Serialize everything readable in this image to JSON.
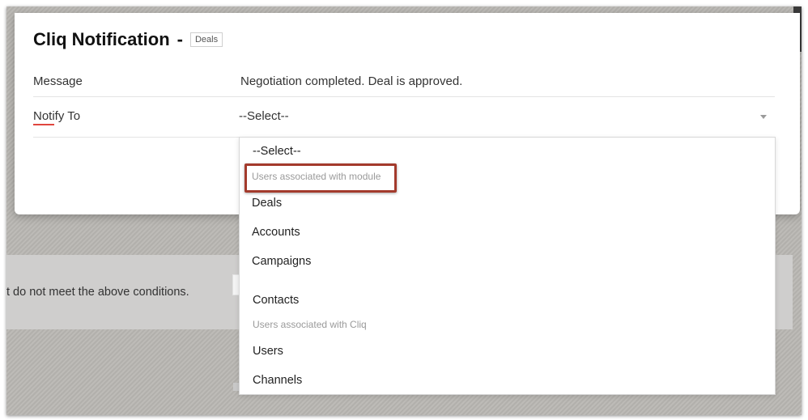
{
  "modal": {
    "title": "Cliq Notification",
    "separator": "-",
    "module_badge": "Deals"
  },
  "fields": {
    "message_label": "Message",
    "message_value": "Negotiation completed. Deal is approved.",
    "notify_label": "Notify To",
    "notify_selected": "--Select--"
  },
  "dropdown": {
    "default_option": "--Select--",
    "groups": [
      {
        "label": "Users associated with module",
        "options": [
          "Deals",
          "Accounts",
          "Campaigns",
          "Contacts"
        ]
      },
      {
        "label": "Users associated with Cliq",
        "options": [
          "Users",
          "Channels"
        ]
      }
    ]
  },
  "background": {
    "row_text": "t do not meet the above conditions."
  },
  "colors": {
    "highlight_border": "#a33a2c",
    "notify_underline": "#e0463e",
    "overlay": "#b9b7b3"
  }
}
